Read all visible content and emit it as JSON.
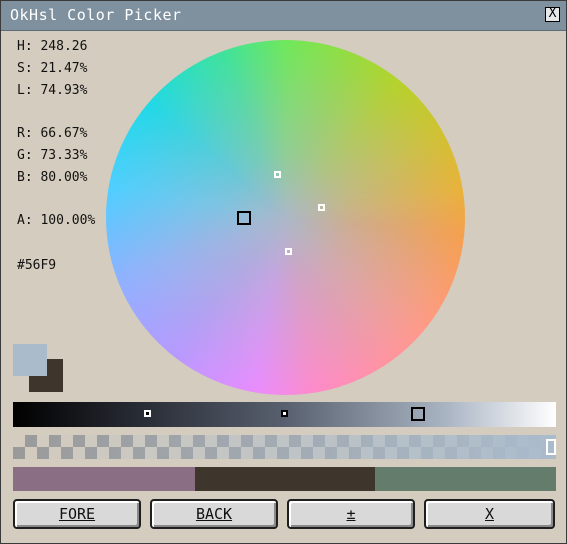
{
  "window": {
    "title": "OkHsl Color Picker",
    "close_label": "X"
  },
  "readouts": {
    "h": "H: 248.26",
    "s": "S: 21.47%",
    "l": "L: 74.93%",
    "r": "R: 66.67%",
    "g": "G: 73.33%",
    "b": "B: 80.00%",
    "a": "A: 100.00%",
    "hex": "#56F9"
  },
  "colors": {
    "foreground": "#aabbcc",
    "background": "#3e352c",
    "palette": [
      "#8a6e84",
      "#3e352c",
      "#647c6c"
    ]
  },
  "buttons": {
    "fore": "FORE",
    "back": "BACK",
    "swap": "±",
    "close": "X"
  },
  "icons": {
    "close": "close-icon"
  }
}
